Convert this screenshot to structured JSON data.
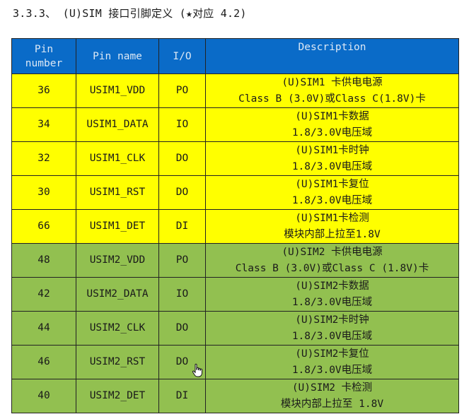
{
  "section": {
    "heading": "3.3.3、 (U)SIM 接口引脚定义 (★对应 4.2)"
  },
  "table": {
    "headers": {
      "pin_number_line1": "Pin",
      "pin_number_line2": "number",
      "pin_name": "Pin name",
      "io": "I/O",
      "description": "Description"
    },
    "rows": [
      {
        "pin": "36",
        "name": "USIM1_VDD",
        "io": "PO",
        "desc1": "(U)SIM1 卡供电电源",
        "desc2": "Class B (3.0V)或Class C(1.8V)卡",
        "group": "sim1"
      },
      {
        "pin": "34",
        "name": "USIM1_DATA",
        "io": "IO",
        "desc1": "(U)SIM1卡数据",
        "desc2": "1.8/3.0V电压域",
        "group": "sim1"
      },
      {
        "pin": "32",
        "name": "USIM1_CLK",
        "io": "DO",
        "desc1": "(U)SIM1卡时钟",
        "desc2": "1.8/3.0V电压域",
        "group": "sim1"
      },
      {
        "pin": "30",
        "name": "USIM1_RST",
        "io": "DO",
        "desc1": "(U)SIM1卡复位",
        "desc2": "1.8/3.0V电压域",
        "group": "sim1"
      },
      {
        "pin": "66",
        "name": "USIM1_DET",
        "io": "DI",
        "desc1": "(U)SIM1卡检测",
        "desc2": "模块内部上拉至1.8V",
        "group": "sim1"
      },
      {
        "pin": "48",
        "name": "USIM2_VDD",
        "io": "PO",
        "desc1": "(U)SIM2 卡供电电源",
        "desc2": "Class B (3.0V)或Class C (1.8V)卡",
        "group": "sim2"
      },
      {
        "pin": "42",
        "name": "USIM2_DATA",
        "io": "IO",
        "desc1": "(U)SIM2卡数据",
        "desc2": "1.8/3.0V电压域",
        "group": "sim2"
      },
      {
        "pin": "44",
        "name": "USIM2_CLK",
        "io": "DO",
        "desc1": "(U)SIM2卡时钟",
        "desc2": "1.8/3.0V电压域",
        "group": "sim2"
      },
      {
        "pin": "46",
        "name": "USIM2_RST",
        "io": "DO",
        "desc1": "(U)SIM2卡复位",
        "desc2": "1.8/3.0V电压域",
        "group": "sim2"
      },
      {
        "pin": "40",
        "name": "USIM2_DET",
        "io": "DI",
        "desc1": "(U)SIM2 卡检测",
        "desc2": "模块内部上拉至 1.8V",
        "group": "sim2"
      }
    ]
  },
  "colors": {
    "header_bg": "#0a6bc8",
    "sim1_row_bg": "#ffff00",
    "sim2_row_bg": "#92c050"
  },
  "cursor_icon": "hand-pointer-icon"
}
